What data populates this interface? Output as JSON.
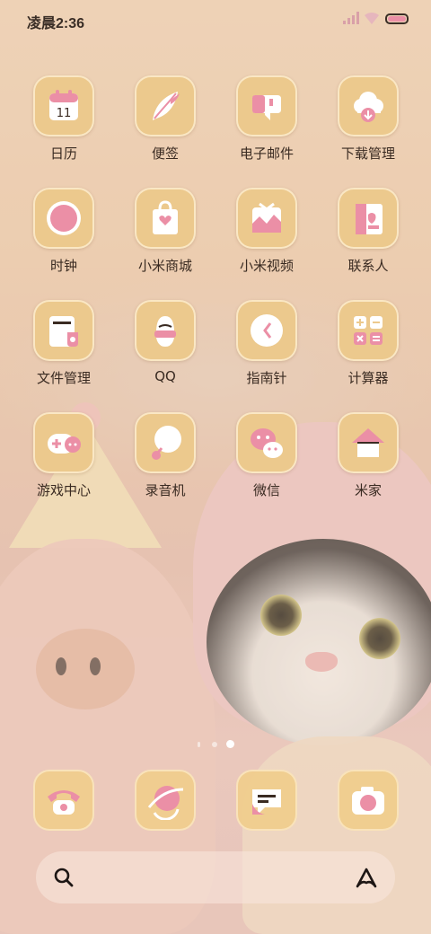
{
  "status_bar": {
    "time": "凌晨2:36"
  },
  "apps": [
    {
      "label": "日历",
      "icon": "calendar-icon",
      "date": "11"
    },
    {
      "label": "便签",
      "icon": "notes-icon"
    },
    {
      "label": "电子邮件",
      "icon": "email-icon"
    },
    {
      "label": "下载管理",
      "icon": "download-icon"
    },
    {
      "label": "时钟",
      "icon": "clock-icon"
    },
    {
      "label": "小米商城",
      "icon": "mi-store-icon"
    },
    {
      "label": "小米视频",
      "icon": "mi-video-icon"
    },
    {
      "label": "联系人",
      "icon": "contacts-icon"
    },
    {
      "label": "文件管理",
      "icon": "file-manager-icon"
    },
    {
      "label": "QQ",
      "icon": "qq-icon"
    },
    {
      "label": "指南针",
      "icon": "compass-icon"
    },
    {
      "label": "计算器",
      "icon": "calculator-icon"
    },
    {
      "label": "游戏中心",
      "icon": "game-center-icon"
    },
    {
      "label": "录音机",
      "icon": "recorder-icon"
    },
    {
      "label": "微信",
      "icon": "wechat-icon"
    },
    {
      "label": "米家",
      "icon": "mijia-icon"
    }
  ],
  "pager": {
    "pages": 3,
    "current": 3
  },
  "dock": [
    {
      "icon": "phone-icon"
    },
    {
      "icon": "browser-icon"
    },
    {
      "icon": "messages-icon"
    },
    {
      "icon": "camera-icon"
    }
  ],
  "search_bar": {
    "left_icon": "search-icon",
    "right_icon": "assistant-icon"
  },
  "colors": {
    "tile": "#ecc98d",
    "icon_pink": "#eb8fa6",
    "icon_white": "#ffffff",
    "text": "#3a2b22"
  }
}
